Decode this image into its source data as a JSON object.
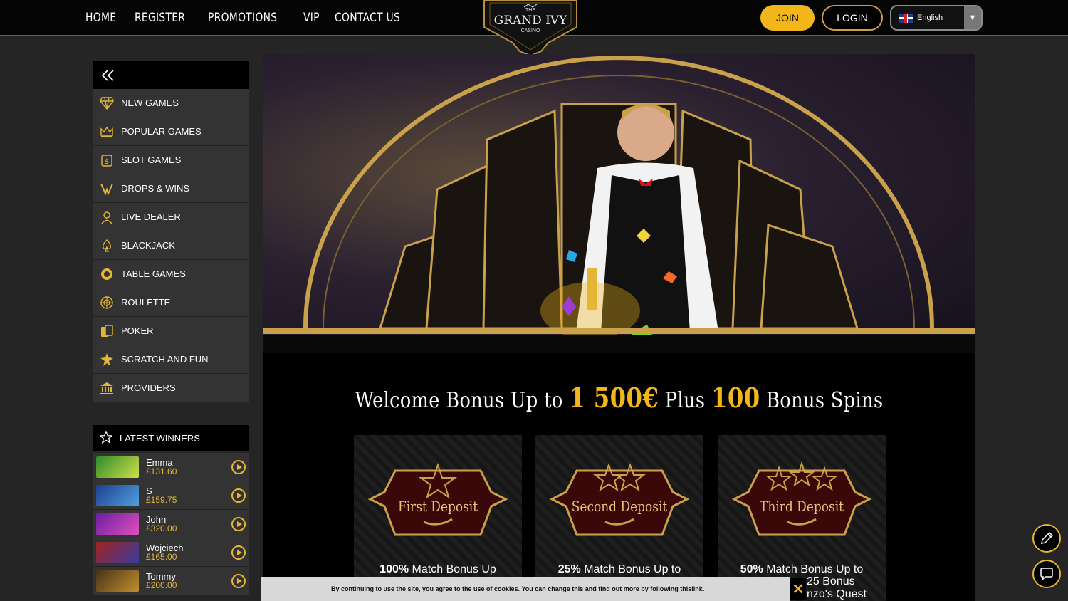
{
  "nav": {
    "items": [
      "HOME",
      "REGISTER",
      "PROMOTIONS",
      "VIP",
      "CONTACT US"
    ]
  },
  "logo": {
    "line1": "THE",
    "line2": "GRAND IVY",
    "line3": "CASINO"
  },
  "header": {
    "join_label": "JOIN",
    "login_label": "LOGIN",
    "language": "English"
  },
  "sidebar": {
    "collapse_icon": "double-chevron-left-icon",
    "items": [
      {
        "label": "NEW GAMES",
        "icon": "diamond-icon"
      },
      {
        "label": "POPULAR GAMES",
        "icon": "crown-icon"
      },
      {
        "label": "SLOT GAMES",
        "icon": "slot-machine-icon"
      },
      {
        "label": "DROPS & WINS",
        "icon": "drops-icon"
      },
      {
        "label": "LIVE DEALER",
        "icon": "dealer-icon"
      },
      {
        "label": "BLACKJACK",
        "icon": "spade-icon"
      },
      {
        "label": "TABLE GAMES",
        "icon": "chip-icon"
      },
      {
        "label": "ROULETTE",
        "icon": "roulette-icon"
      },
      {
        "label": "POKER",
        "icon": "cards-icon"
      },
      {
        "label": "SCRATCH AND FUN",
        "icon": "scratch-icon"
      },
      {
        "label": "PROVIDERS",
        "icon": "bank-icon"
      }
    ]
  },
  "latest_winners": {
    "title": "LATEST WINNERS",
    "rows": [
      {
        "name": "Emma",
        "amount": "£131.60",
        "thumb_color": "#2f8a2a"
      },
      {
        "name": "S",
        "amount": "£159.75",
        "thumb_color": "#2a5fb0"
      },
      {
        "name": "John",
        "amount": "£320.00",
        "thumb_color": "#8a2ab0"
      },
      {
        "name": "Wojciech",
        "amount": "£165.00",
        "thumb_color": "#b03a2a"
      },
      {
        "name": "Tommy",
        "amount": "£200.00",
        "thumb_color": "#6b4a1e"
      }
    ]
  },
  "bonus": {
    "prefix": "Welcome Bonus Up to",
    "amount": "1 500€",
    "mid": "Plus",
    "spins": "100",
    "suffix": "Bonus Spins"
  },
  "deposits": [
    {
      "label": "First Deposit",
      "stars": 1,
      "pct": "100%",
      "desc": "Match Bonus Up"
    },
    {
      "label": "Second Deposit",
      "stars": 2,
      "pct": "25%",
      "desc": "Match Bonus Up to"
    },
    {
      "label": "Third Deposit",
      "stars": 3,
      "pct": "50%",
      "desc": "Match Bonus Up to"
    }
  ],
  "cookie": {
    "text": "By continuing to use the site, you agree to the use of cookies. You can change this and find out more by following this ",
    "link": "link",
    "end": ".",
    "close": "✕"
  },
  "overlap_text": {
    "line1": "25 Bonus",
    "line2": "nzo's Quest"
  },
  "colors": {
    "gold": "#f3b61a",
    "accent_border": "#c9a14a",
    "panel": "#333333"
  }
}
